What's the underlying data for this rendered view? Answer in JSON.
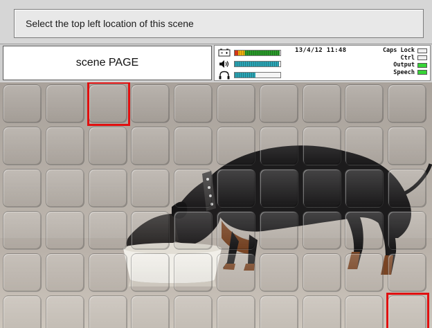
{
  "instruction": {
    "text": "Select the top left location of this scene"
  },
  "page_label": {
    "text": "scene PAGE"
  },
  "status": {
    "datetime": "13/4/12 11:48",
    "meters": [
      {
        "icon": "battery-icon",
        "level": 0.98,
        "color": "#2a9a2a"
      },
      {
        "icon": "speaker-icon",
        "level": 0.97,
        "color": "#2ca5b5"
      },
      {
        "icon": "headphones-icon",
        "level": 0.45,
        "color": "#2ca5b5"
      }
    ],
    "keys": [
      {
        "label": "Caps Lock",
        "on": false
      },
      {
        "label": "Ctrl",
        "on": false
      },
      {
        "label": "Output",
        "on": true
      },
      {
        "label": "Speech",
        "on": true
      }
    ],
    "colors": {
      "indicator_on": "#36d436",
      "indicator_off": "#efefef",
      "battery_low": "#e23a1a",
      "battery_mid": "#f2b20e"
    }
  },
  "scene": {
    "description_icon": "dog-eating-photo",
    "grid": {
      "columns": 10,
      "rows": 6
    },
    "selection_color": "#e01010",
    "selected_cells": [
      {
        "column": 3,
        "row": 1,
        "label": "top-left-selection"
      },
      {
        "column": 10,
        "row": 6,
        "label": "bottom-right-selection"
      }
    ]
  }
}
